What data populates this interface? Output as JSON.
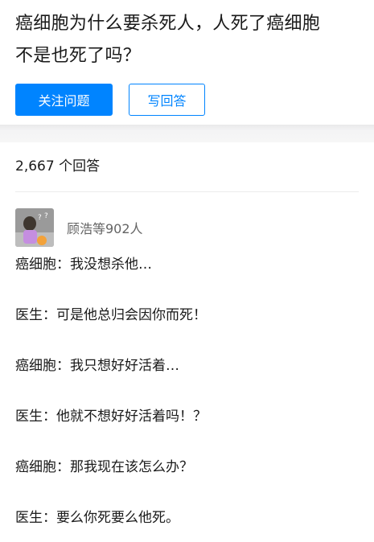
{
  "question": {
    "title_line1": "癌细胞为什么要杀死人，人死了癌细胞",
    "title_line2": "不是也死了吗？",
    "follow_label": "关注问题",
    "write_answer_label": "写回答"
  },
  "answers": {
    "count_label": "2,667 个回答",
    "first_answer": {
      "voters_label": "顾浩等902人",
      "lines": [
        "癌细胞：我没想杀他…",
        "医生：可是他总归会因你而死！",
        "癌细胞：我只想好好活着…",
        "医生：他就不想好好活着吗！？",
        "癌细胞：那我现在该怎么办？",
        "医生：要么你死要么他死。"
      ]
    }
  },
  "colors": {
    "accent": "#0084ff",
    "text": "#1a1a1a",
    "muted": "#646464",
    "band": "#f6f6f6"
  }
}
